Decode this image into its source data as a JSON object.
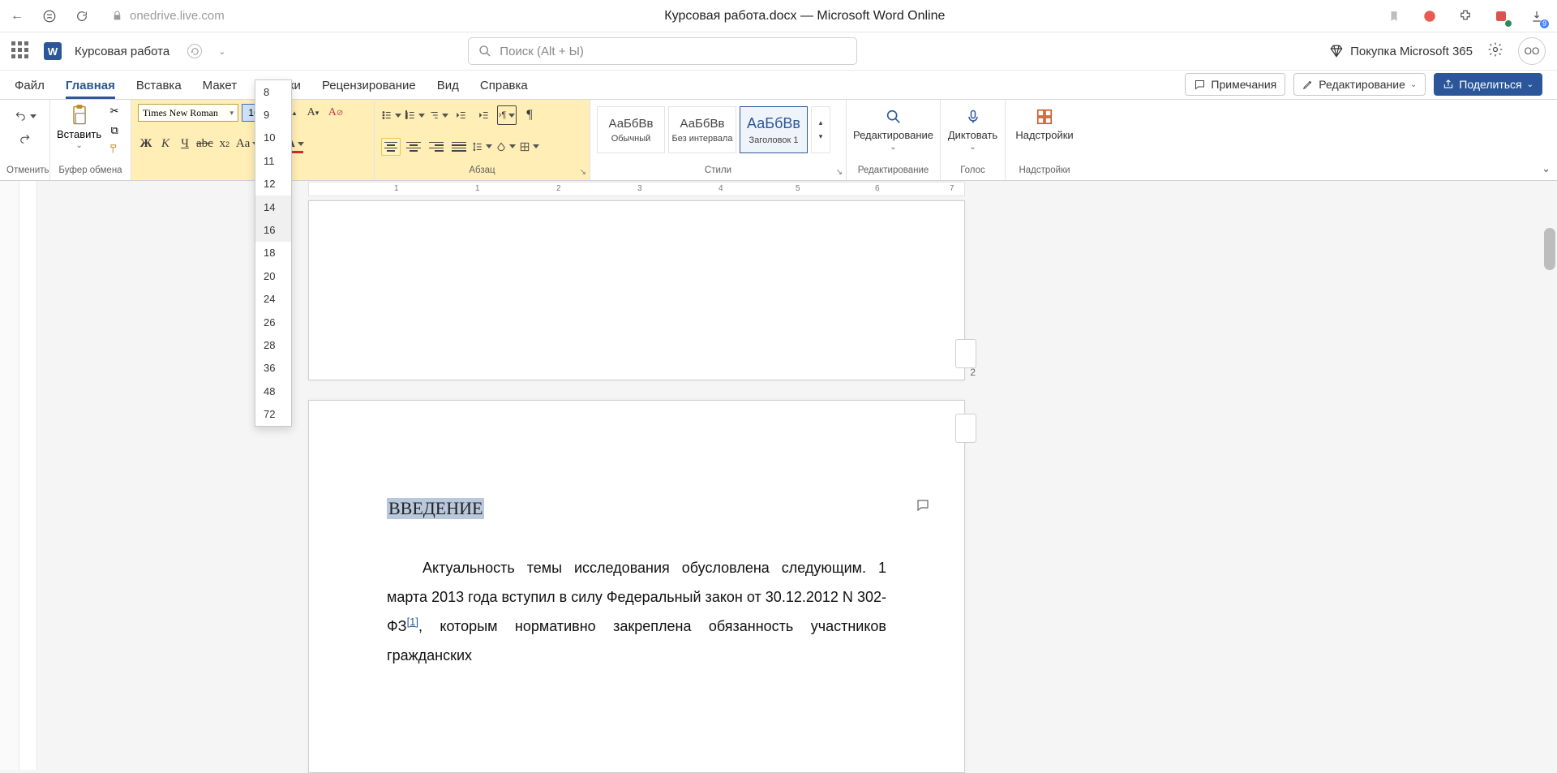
{
  "browser": {
    "url_host": "onedrive.live.com",
    "title": "Курсовая работа.docx — Microsoft Word Online",
    "download_badge": "9"
  },
  "header": {
    "doc_name": "Курсовая работа",
    "search_placeholder": "Поиск (Alt + Ы)",
    "premium_label": "Покупка Microsoft 365",
    "avatar": "ОО"
  },
  "tabs": {
    "items": [
      "Файл",
      "Главная",
      "Вставка",
      "Макет",
      "Ссылки",
      "Рецензирование",
      "Вид",
      "Справка"
    ],
    "active": "Главная",
    "comments_btn": "Примечания",
    "editing_btn": "Редактирование",
    "share_btn": "Поделиться"
  },
  "ribbon": {
    "undo_label": "Отменить",
    "clipboard": {
      "paste": "Вставить",
      "group_label": "Буфер обмена"
    },
    "font": {
      "name": "Times New Roman",
      "size": "16",
      "bold": "Ж",
      "italic": "К",
      "underline": "Ч",
      "strike": "abc",
      "sub": "x",
      "caseAa": "Aa"
    },
    "paragraph_label": "Абзац",
    "styles": {
      "items": [
        {
          "preview": "АаБбВв",
          "label": "Обычный"
        },
        {
          "preview": "АаБбВв",
          "label": "Без интервала"
        },
        {
          "preview": "АаБбВв",
          "label": "Заголовок 1"
        }
      ],
      "group_label": "Стили"
    },
    "editing_group": {
      "label": "Редактирование",
      "sub": "Редактирование"
    },
    "dictate": {
      "label": "Диктовать",
      "sub": "Голос"
    },
    "addins": {
      "label": "Надстройки",
      "sub": "Надстройки"
    }
  },
  "size_menu": [
    "8",
    "9",
    "10",
    "11",
    "12",
    "14",
    "16",
    "18",
    "20",
    "24",
    "26",
    "28",
    "36",
    "48",
    "72"
  ],
  "size_menu_highlight": [
    "14",
    "16"
  ],
  "ruler_marks": [
    "1",
    "1",
    "2",
    "3",
    "4",
    "5",
    "6",
    "7"
  ],
  "document": {
    "page_number": "2",
    "heading": "ВВЕДЕНИЕ",
    "body_prefix": "Актуальность темы исследования обусловлена следующим. 1 марта 2013 года вступил в силу Федеральный закон от 30.12.2012 N 302-ФЗ",
    "footnote": "[1]",
    "body_suffix": ", которым нормативно закреплена обязанность участников гражданских"
  }
}
